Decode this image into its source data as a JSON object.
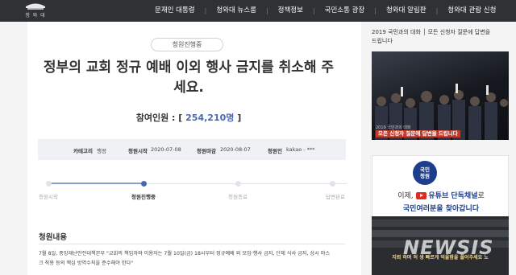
{
  "header": {
    "logo_text": "청 와 대",
    "nav": [
      "문재인 대통령",
      "청와대 뉴스룸",
      "정책정보",
      "국민소통 광장",
      "청와대 알림판",
      "청와대 관람 신청"
    ]
  },
  "petition": {
    "status": "청원진행중",
    "title": "정부의 교회 정규 예배 이외 행사 금지를 취소해 주세요.",
    "count_label": "참여인원 : [",
    "count_value": "254,210명",
    "count_close": "]",
    "meta": {
      "category_label": "카테고리",
      "category_value": "행정",
      "start_label": "청원시작",
      "start_value": "2020-07-08",
      "end_label": "청원마감",
      "end_value": "2020-08-07",
      "author_label": "청원인",
      "author_value": "kakao - ***"
    },
    "steps": [
      "청원시작",
      "청원진행중",
      "청원종료",
      "답변완료"
    ],
    "active_step": 2,
    "section_title": "청원내용",
    "body_line1": "7월 8일, 중앙재난안전대책본부 \"교회의 책임자와 이용자는 7월 10일(금) 18시부터 정규예배 외 모임·행사 금지, 단체 식사 금지, 상시 마스",
    "body_line2": "크 착용 등의 핵심 방역수칙을 준수해야 한다\""
  },
  "sidebar": {
    "banner1_line1": "2019 국민과의 대화 │ 모든 신청자 질문에 답변을",
    "banner1_line2": "드립니다",
    "banner1_caption": "2019 국민과의 대화",
    "banner1_band": "모든 신청자 질문에 답변을 드립니다",
    "banner2_logo": "국민\n청원",
    "banner2_line1_a": "이제,",
    "banner2_line1_b": "유튜브 단독채널",
    "banner2_line1_c": "로",
    "banner2_line2": "국민여러분을 찾아갑니다",
    "banner3_text": "지뢰 하며 허 생 빠르게 억울함을 풀어주세요\n노"
  },
  "watermark": "NEWSIS",
  "colors": {
    "topbar": "#2f3134",
    "accent": "#4a67b3",
    "youtube_red": "#e02a1f",
    "navy": "#1d3e8c"
  }
}
